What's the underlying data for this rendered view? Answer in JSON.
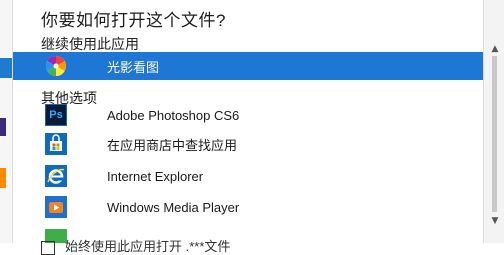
{
  "dialog": {
    "title": "你要如何打开这个文件?",
    "continue_section_label": "继续使用此应用",
    "other_options_label": "其他选项",
    "checkbox_label": "始终使用此应用打开 .***文件"
  },
  "default_app": {
    "label": "光影看图",
    "icon": "pinwheel-photo-icon"
  },
  "apps": [
    {
      "label": "Adobe Photoshop CS6",
      "icon": "photoshop-icon",
      "icon_text": "Ps"
    },
    {
      "label": "在应用商店中查找应用",
      "icon": "store-icon"
    },
    {
      "label": "Internet Explorer",
      "icon": "internet-explorer-icon"
    },
    {
      "label": "Windows Media Player",
      "icon": "windows-media-player-icon"
    },
    {
      "label": "",
      "icon": "app-icon"
    }
  ],
  "colors": {
    "selection": "#1e77d4",
    "ps_bg": "#0a1c36",
    "ps_text": "#31a8ff",
    "store_blue": "#0f6cbd",
    "accent_green": "#3fae49"
  }
}
